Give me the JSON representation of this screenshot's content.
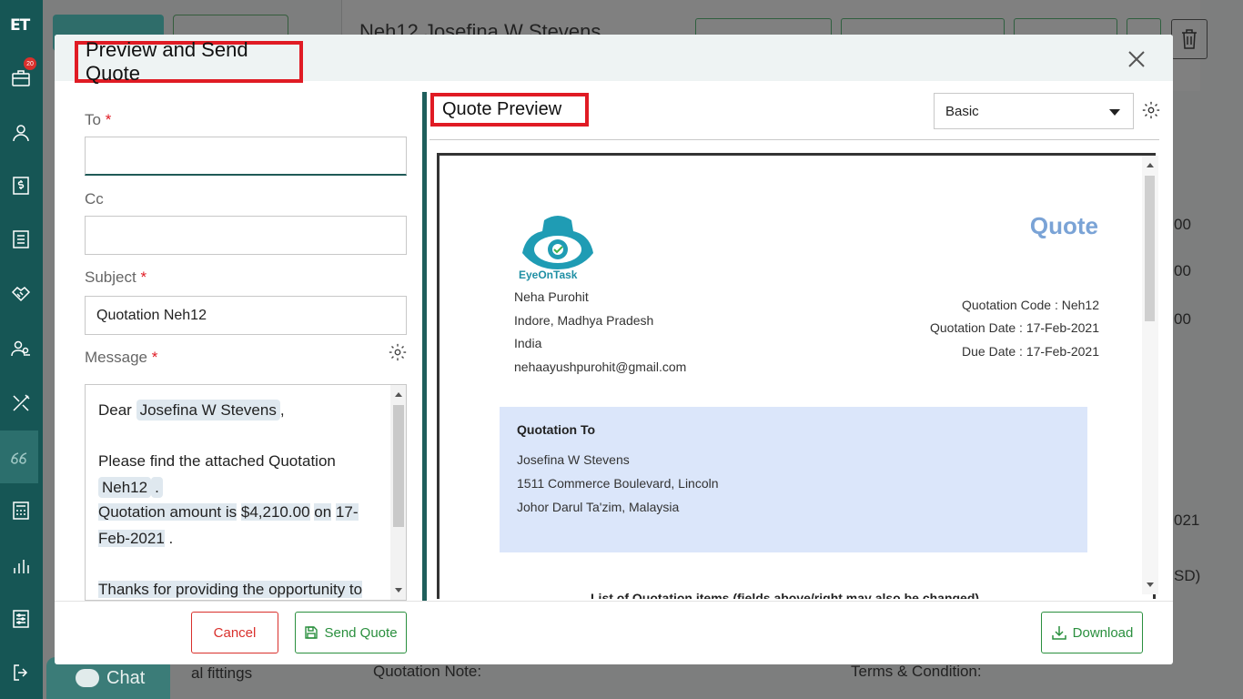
{
  "sidebar": {
    "logo": "ET",
    "badge_count": "20",
    "icons": [
      "briefcase-icon",
      "person-icon",
      "dollar-icon",
      "list-icon",
      "handshake-icon",
      "users-icon",
      "tools-icon",
      "quote-icon",
      "calculator-icon",
      "chart-icon",
      "settings-sliders-icon",
      "logout-icon"
    ]
  },
  "background": {
    "title": "Neh12  Josefina W Stevens",
    "right_values": [
      "00",
      "00",
      "00",
      "021",
      "SD)"
    ],
    "bottom_left": "al fittings",
    "quotation_note": "Quotation Note:",
    "terms": "Terms & Condition:",
    "chat_label": "Chat"
  },
  "modal": {
    "title": "Preview and Send Quote",
    "form": {
      "to_label": "To",
      "to_value": "",
      "cc_label": "Cc",
      "cc_value": "",
      "subject_label": "Subject",
      "subject_value": "Quotation Neh12",
      "message_label": "Message",
      "required_mark": "*"
    },
    "message": {
      "greeting_prefix": "Dear",
      "customer": "Josefina W Stevens",
      "greeting_suffix": ",",
      "line2_prefix": "Please find the attached Quotation",
      "quote_code": "Neh12",
      "line2_suffix": ".",
      "line3_prefix": "Quotation amount is",
      "amount": "$4,210.00",
      "line3_mid": "on",
      "date": "17-Feb-2021",
      "line3_suffix": ".",
      "line4": "Thanks for providing the opportunity to"
    },
    "preview": {
      "title": "Quote Preview",
      "template_selected": "Basic"
    },
    "document": {
      "logo_text": "EyeOnTask",
      "heading": "Quote",
      "from_name": "Neha Purohit",
      "from_city": "Indore, Madhya Pradesh",
      "from_country": "India",
      "from_email": "nehaayushpurohit@gmail.com",
      "quotation_code": "Quotation Code : Neh12",
      "quotation_date": "Quotation Date : 17-Feb-2021",
      "due_date": "Due Date : 17-Feb-2021",
      "to_title": "Quotation To",
      "to_name": "Josefina W Stevens",
      "to_address1": "1511 Commerce Boulevard, Lincoln",
      "to_address2": "Johor Darul Ta'zim, Malaysia",
      "cut_text": "List of Quotation items (fields above/right may also be changed)"
    },
    "buttons": {
      "cancel": "Cancel",
      "send": "Send Quote",
      "download": "Download"
    }
  },
  "colors": {
    "sidebar_bg": "#165655",
    "accent_green": "#2a8f3e",
    "danger_red": "#d9302c",
    "highlight_border": "#e01b24",
    "doc_heading": "#7aa3d6",
    "doc_box": "#dbe6fa"
  }
}
